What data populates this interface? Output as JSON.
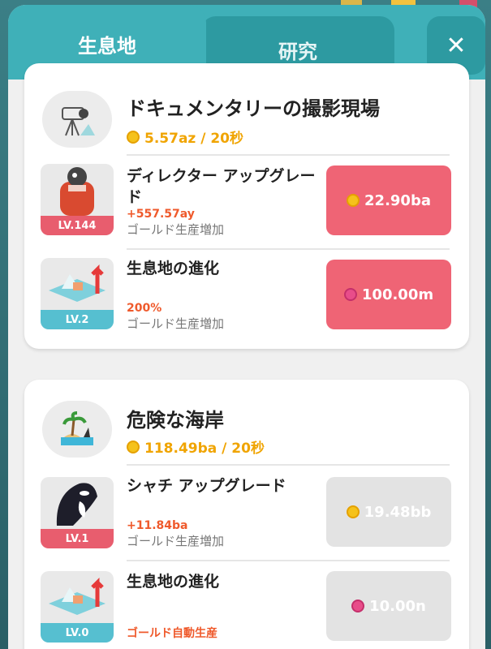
{
  "tabs": {
    "habitat": "生息地",
    "research": "研究",
    "close": "✕"
  },
  "colors": {
    "accent": "#3fb0b8",
    "buy": "#ef6475",
    "gold": "#f0a400",
    "level_red": "#e85d6e",
    "level_teal": "#56bfd0"
  },
  "habitats": [
    {
      "name": "ドキュメンタリーの撮影現場",
      "icon": "camera-tripod-icon",
      "rate": "5.57az / 20秒",
      "upgrades": [
        {
          "title": "ディレクター アップグレード",
          "level": "LV.144",
          "value": "+557.57ay",
          "desc": "ゴールド生産増加",
          "cost": "22.90ba",
          "currency": "coin-icon",
          "state": "active"
        },
        {
          "title": "生息地の進化",
          "level": "LV.2",
          "value": "200%",
          "desc": "ゴールド生産増加",
          "cost": "100.00m",
          "currency": "gem-icon",
          "state": "active"
        }
      ]
    },
    {
      "name": "危険な海岸",
      "icon": "palm-island-icon",
      "rate": "118.49ba / 20秒",
      "upgrades": [
        {
          "title": "シャチ アップグレード",
          "level": "LV.1",
          "value": "+11.84ba",
          "desc": "ゴールド生産増加",
          "cost": "19.48bb",
          "currency": "coin-icon",
          "state": "disabled"
        },
        {
          "title": "生息地の進化",
          "level": "LV.0",
          "value": "ゴールド自動生産",
          "desc": "",
          "cost": "10.00n",
          "currency": "gem-icon",
          "state": "disabled"
        }
      ]
    }
  ]
}
